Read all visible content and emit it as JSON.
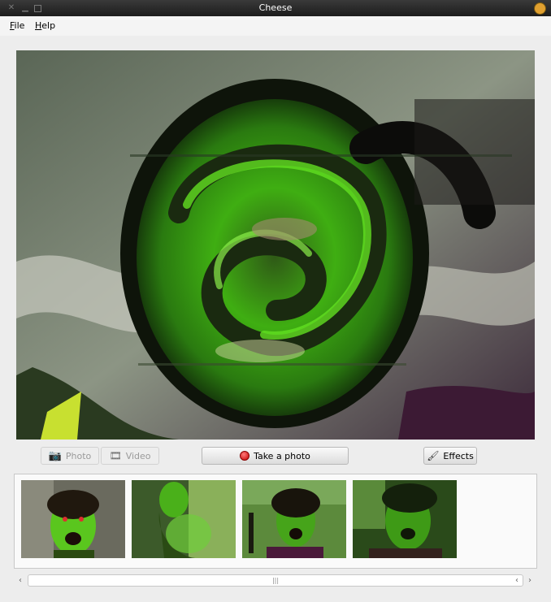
{
  "window": {
    "title": "Cheese"
  },
  "menu": [
    {
      "label": "File",
      "mnemonic": "F",
      "rest": "ile"
    },
    {
      "label": "Help",
      "mnemonic": "H",
      "rest": "elp"
    }
  ],
  "mode": {
    "photo_label": "Photo",
    "video_label": "Video",
    "selected": "Photo"
  },
  "actions": {
    "take_photo_label": "Take a photo",
    "effects_label": "Effects"
  },
  "gallery": {
    "items": [
      {
        "name": "photo-1"
      },
      {
        "name": "photo-2"
      },
      {
        "name": "photo-3"
      },
      {
        "name": "photo-4"
      }
    ]
  },
  "scrollbar": {
    "left_arrow": "‹",
    "right_arrow": "›",
    "grip": "|||"
  },
  "colors": {
    "effect_green": "#35d400",
    "record": "#d40000"
  }
}
